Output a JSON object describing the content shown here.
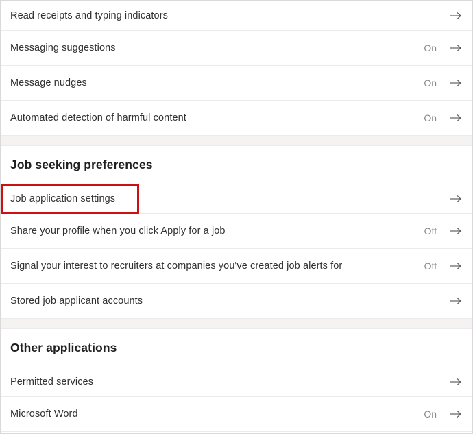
{
  "page": {
    "title": "Privacy and settings list",
    "highlight_color": "#cc1111",
    "accent_band_color": "#f4f3f2",
    "divider_color": "#eceaea",
    "label_color": "#323130",
    "value_color": "#8a8886"
  },
  "sections": [
    {
      "heading": null,
      "rows": [
        {
          "label": "Read receipts and typing indicators",
          "value": "",
          "arrow": "arrow-right-icon"
        },
        {
          "label": "Messaging suggestions",
          "value": "On",
          "arrow": "arrow-right-icon"
        },
        {
          "label": "Message nudges",
          "value": "On",
          "arrow": "arrow-right-icon"
        },
        {
          "label": "Automated detection of harmful content",
          "value": "On",
          "arrow": "arrow-right-icon"
        }
      ]
    },
    {
      "heading": "Job seeking preferences",
      "rows": [
        {
          "label": "Job application settings",
          "value": "",
          "arrow": "arrow-right-icon",
          "highlighted": true
        },
        {
          "label": "Share your profile when you click Apply for a job",
          "value": "Off",
          "arrow": "arrow-right-icon"
        },
        {
          "label": "Signal your interest to recruiters at companies you've created job alerts for",
          "value": "Off",
          "arrow": "arrow-right-icon"
        },
        {
          "label": "Stored job applicant accounts",
          "value": "",
          "arrow": "arrow-right-icon"
        }
      ]
    },
    {
      "heading": "Other applications",
      "rows": [
        {
          "label": "Permitted services",
          "value": "",
          "arrow": "arrow-right-icon"
        },
        {
          "label": "Microsoft Word",
          "value": "On",
          "arrow": "arrow-right-icon"
        }
      ]
    }
  ]
}
